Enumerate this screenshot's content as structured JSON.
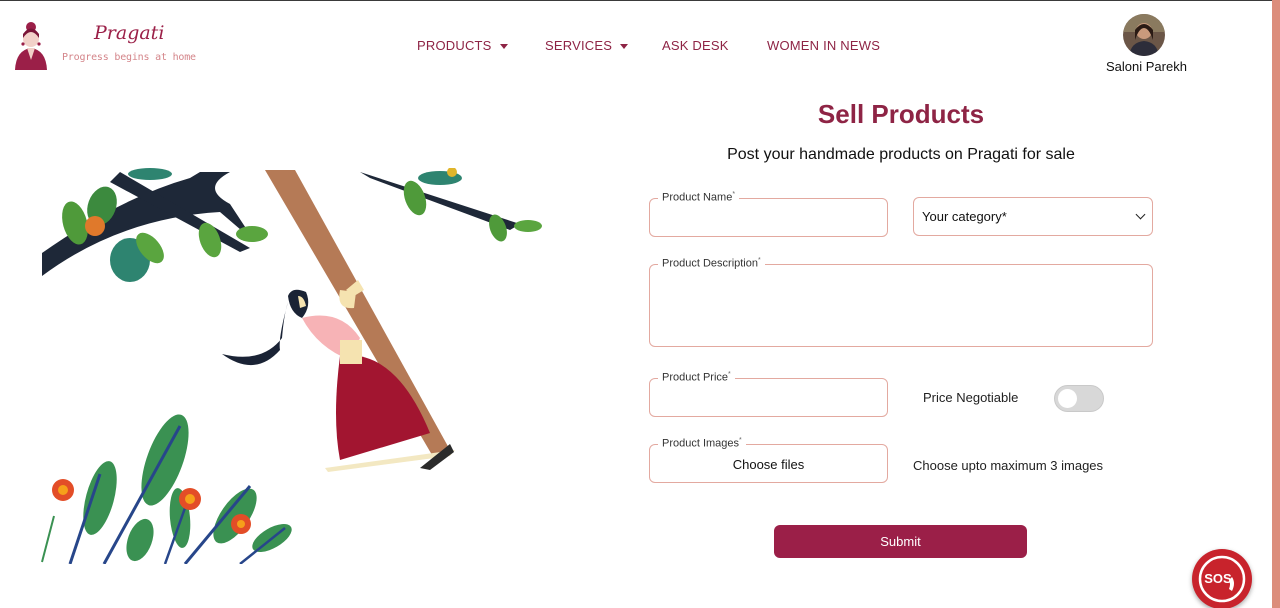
{
  "brand": {
    "name": "Pragati",
    "tagline": "Progress begins at home"
  },
  "nav": {
    "products": "PRODUCTS",
    "services": "SERVICES",
    "ask_desk": "ASK DESK",
    "women_in_news": "WOMEN IN NEWS"
  },
  "user": {
    "name": "Saloni Parekh"
  },
  "form": {
    "title": "Sell Products",
    "subtitle": "Post your handmade products on Pragati for sale",
    "product_name_label": "Product Name",
    "category_value": "Your category*",
    "description_label": "Product Description",
    "price_label": "Product Price",
    "negotiable_label": "Price Negotiable",
    "negotiable_on": false,
    "images_label": "Product Images",
    "choose_files": "Choose files",
    "images_hint": "Choose upto maximum 3 images",
    "submit": "Submit",
    "required_mark": "*"
  },
  "sos": {
    "label": "SOS"
  },
  "colors": {
    "brand": "#9b1f48",
    "field_border": "#e3a9a0",
    "tagline": "#d4858a"
  }
}
